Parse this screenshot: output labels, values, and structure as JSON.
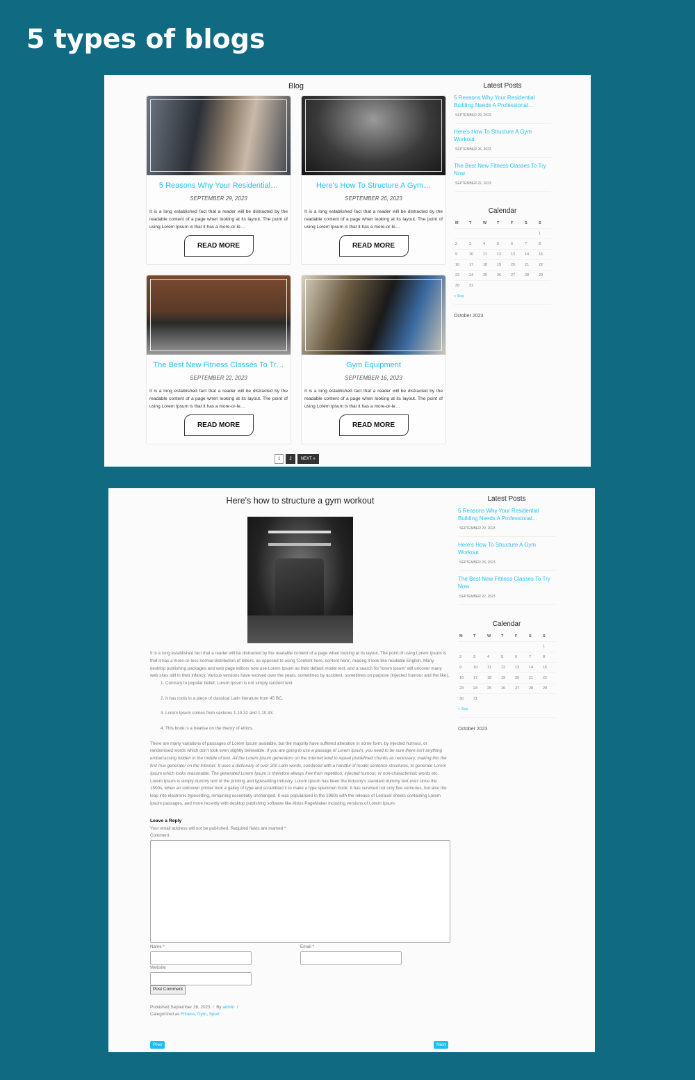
{
  "hero_title": "5 types of blogs",
  "colors": {
    "background": "#0f6a82",
    "accent": "#27c0ef",
    "button_dark": "#333333"
  },
  "blog": {
    "title": "Blog",
    "read_more": "READ MORE",
    "posts": [
      {
        "title": "5 Reasons Why Your Residential…",
        "date": "SEPTEMBER 29, 2023",
        "excerpt": "It is a long established fact that a reader will be distracted by the readable content of a page when looking at its layout. The point of using Lorem Ipsum is that it has a more-or-le…",
        "image": "gym-cardio-couple-photo"
      },
      {
        "title": "Here's How To Structure A Gym…",
        "date": "SEPTEMBER 26, 2023",
        "excerpt": "It is a long established fact that a reader will be distracted by the readable content of a page when looking at its layout. The point of using Lorem Ipsum is that it has a more-or-le…",
        "image": "gym-interior-bw-photo"
      },
      {
        "title": "The Best New Fitness Classes To Tr…",
        "date": "SEPTEMBER 22, 2023",
        "excerpt": "It is a long established fact that a reader will be distracted by the readable content of a page when looking at its layout. The point of using Lorem Ipsum is that it has a more-or-le…",
        "image": "squat-class-photo"
      },
      {
        "title": "Gym Equipment",
        "date": "SEPTEMBER 16, 2023",
        "excerpt": "It is a long established fact that a reader will be distracted by the readable content of a page when looking at its layout. The point of using Lorem Ipsum is that it has a more-or-le…",
        "image": "dumbbell-rack-photo"
      }
    ],
    "pagination": [
      "1",
      "2",
      "NEXT »"
    ]
  },
  "sidebar": {
    "latest_title": "Latest Posts",
    "latest": [
      {
        "title": "5 Reasons Why Your Residential Building Needs A Professional…",
        "date": "SEPTEMBER 29, 2023"
      },
      {
        "title": "Here's How To Structure A Gym Workout",
        "date": "SEPTEMBER 26, 2023"
      },
      {
        "title": "The Best New Fitness Classes To Try Now",
        "date": "SEPTEMBER 22, 2023"
      }
    ],
    "calendar_title": "Calendar",
    "weekdays": [
      "M",
      "T",
      "W",
      "T",
      "F",
      "S",
      "S"
    ],
    "weeks": [
      [
        "",
        "",
        "",
        "",
        "",
        "",
        "1"
      ],
      [
        "2",
        "3",
        "4",
        "5",
        "6",
        "7",
        "8"
      ],
      [
        "9",
        "10",
        "11",
        "12",
        "13",
        "14",
        "15"
      ],
      [
        "16",
        "17",
        "18",
        "19",
        "20",
        "21",
        "22"
      ],
      [
        "23",
        "24",
        "25",
        "26",
        "27",
        "28",
        "29"
      ],
      [
        "30",
        "31",
        "",
        "",
        "",
        "",
        ""
      ]
    ],
    "prev": "« Sep",
    "month": "October 2023"
  },
  "post": {
    "title": "Here's how to structure a gym workout",
    "image": "gym-machine-bw-photo",
    "para1": "It is a long established fact that a reader will be distracted by the readable content of a page when looking at its layout. The point of using Lorem Ipsum is that it has a more-or-less normal distribution of letters, as opposed to using 'Content here, content here', making it look like readable English. Many desktop publishing packages and web page editors now use Lorem Ipsum as their default model text, and a search for 'lorem ipsum' will uncover many web sites still in their infancy. Various versions have evolved over the years, sometimes by accident, sometimes on purpose (injected humour and the like).",
    "list": [
      "Contrary to popular belief, Lorem Ipsum is not simply random text.",
      "It has roots in a piece of classical Latin literature from 45 BC.",
      "Lorem Ipsum comes from sections 1.10.32 and 1.10.33.",
      "This book is a treatise on the theory of ethics."
    ],
    "para2a": "There are many variations of passages of Lorem Ipsum available, but the majority have suffered alteration in some form, by injected humour, or randomised words which don't look even slightly believable. ",
    "para2i": "If you are going to use a passage of Lorem Ipsum, you need to be sure there isn't anything embarrassing hidden in the middle of text. All the Lorem Ipsum generators on the Internet tend to repeat predefined chunks as necessary, making this the first true generator on the Internet. It uses a dictionary of over 200 Latin words, combined with a handful of model sentence structures, to generate Lorem Ipsum which looks reasonable. The generated Lorem Ipsum is therefore always free from repetition, injected humour, or non-characteristic words etc.",
    "para2b": " Lorem Ipsum is simply dummy text of the printing and typesetting industry. Lorem Ipsum has been the industry's standard dummy text ever since the 1500s, when an unknown printer took a galley of type and scrambled it to make a type specimen book. It has survived not only five centuries, but also the leap into electronic typesetting, remaining essentially unchanged. It was popularised in the 1960s with the release of Letraset sheets containing Lorem Ipsum passages, and more recently with desktop publishing software like Aldus PageMaker including versions of Lorem Ipsum.",
    "reply_title": "Leave a Reply",
    "reply_note": "Your email address will not be published. Required fields are marked *",
    "comment_label": "Comment",
    "name_label": "Name *",
    "email_label": "Email *",
    "website_label": "Website",
    "submit": "Post Comment",
    "published": "Published September 26, 2023",
    "by": "By",
    "author": "admin",
    "categorized": "Categorized as",
    "categories": [
      "Fitness",
      "Gym",
      "Sport"
    ],
    "prev": "Prev",
    "next": "Next"
  }
}
